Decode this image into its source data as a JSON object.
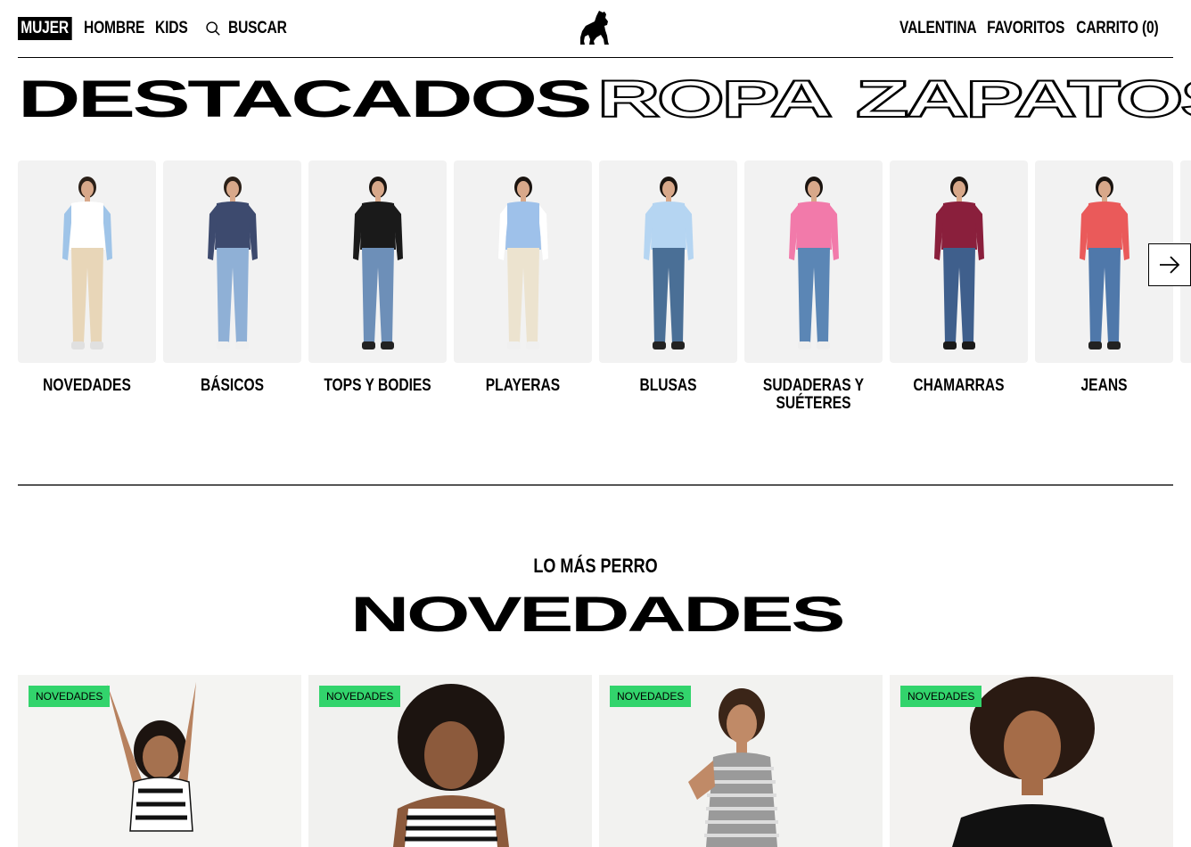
{
  "header": {
    "nav": [
      "MUJER",
      "HOMBRE",
      "KIDS"
    ],
    "search_label": "BUSCAR",
    "right": [
      "VALENTINA",
      "FAVORITOS",
      "CARRITO (0)"
    ]
  },
  "categories": [
    "DESTACADOS",
    "ROPA",
    "ZAPATOS"
  ],
  "featured": [
    {
      "label": "NOVEDADES",
      "top": "#ffffff",
      "sleeve": "#9fc4e8",
      "bottom": "#e8d6b8",
      "hair": "#2b2018",
      "shoe": "#e0e0e0"
    },
    {
      "label": "BÁSICOS",
      "top": "#3d4a6e",
      "sleeve": "#3d4a6e",
      "bottom": "#8fb0d6",
      "hair": "#2b2018",
      "shoe": "#f0f0f0"
    },
    {
      "label": "TOPS Y BODIES",
      "top": "#1a1a1a",
      "sleeve": "#1a1a1a",
      "bottom": "#6d8fb8",
      "hair": "#1a1410",
      "shoe": "#222222"
    },
    {
      "label": "PLAYERAS",
      "top": "#9ec1ea",
      "sleeve": "#ffffff",
      "bottom": "#ece3cf",
      "hair": "#1a1410",
      "shoe": "#f0f0f0"
    },
    {
      "label": "BLUSAS",
      "top": "#b5d5f2",
      "sleeve": "#b5d5f2",
      "bottom": "#4a6f96",
      "hair": "#1a1410",
      "shoe": "#222222"
    },
    {
      "label": "SUDADERAS Y SUÉTERES",
      "top": "#f27aaa",
      "sleeve": "#f27aaa",
      "bottom": "#5b86b5",
      "hair": "#1a1410",
      "shoe": "#eeeeee"
    },
    {
      "label": "CHAMARRAS",
      "top": "#8a1f3c",
      "sleeve": "#8a1f3c",
      "bottom": "#3f5f8c",
      "hair": "#1a1410",
      "shoe": "#1a1a1a"
    },
    {
      "label": "JEANS",
      "top": "#ea5a5a",
      "sleeve": "#ea5a5a",
      "bottom": "#4f78aa",
      "hair": "#1a1410",
      "shoe": "#222222"
    }
  ],
  "section": {
    "kicker": "LO MÁS PERRO",
    "title": "NOVEDADES"
  },
  "products": [
    {
      "badge": "NOVEDADES"
    },
    {
      "badge": "NOVEDADES"
    },
    {
      "badge": "NOVEDADES"
    },
    {
      "badge": "NOVEDADES"
    }
  ]
}
